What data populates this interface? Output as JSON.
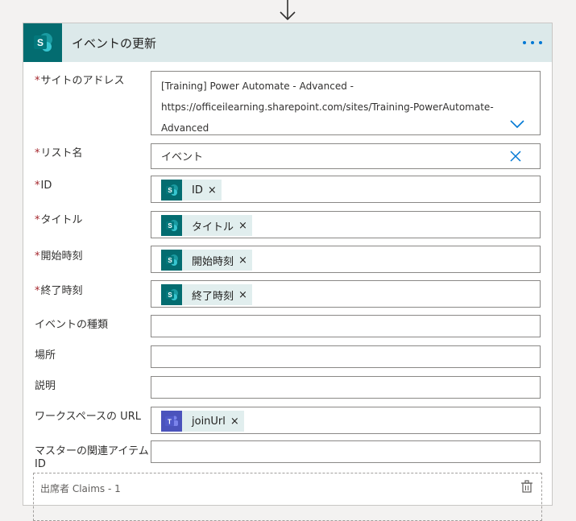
{
  "card": {
    "title": "イベントの更新",
    "icon": "sharepoint-icon",
    "brand_color": "#036c70",
    "header_color": "#dce9ea"
  },
  "fields": {
    "site": {
      "label": "サイトのアドレス",
      "required": true,
      "value_line1": "[Training] Power Automate - Advanced -",
      "value_line2": "https://officeilearning.sharepoint.com/sites/Training-PowerAutomate-",
      "value_line3": "Advanced"
    },
    "list": {
      "label": "リスト名",
      "required": true,
      "value": "イベント"
    },
    "id": {
      "label": "ID",
      "required": true,
      "token": "ID"
    },
    "title": {
      "label": "タイトル",
      "required": true,
      "token": "タイトル"
    },
    "start": {
      "label": "開始時刻",
      "required": true,
      "token": "開始時刻"
    },
    "end": {
      "label": "終了時刻",
      "required": true,
      "token": "終了時刻"
    },
    "event_type": {
      "label": "イベントの種類",
      "value": ""
    },
    "location": {
      "label": "場所",
      "value": ""
    },
    "description": {
      "label": "説明",
      "value": ""
    },
    "workspace_url": {
      "label": "ワークスペースの URL",
      "token": "joinUrl",
      "token_icon": "teams-icon"
    },
    "master_item": {
      "label": "マスターの関連アイテム ID",
      "value": ""
    }
  },
  "attendees": {
    "label": "出席者 Claims - 1"
  },
  "required_marker": "*"
}
